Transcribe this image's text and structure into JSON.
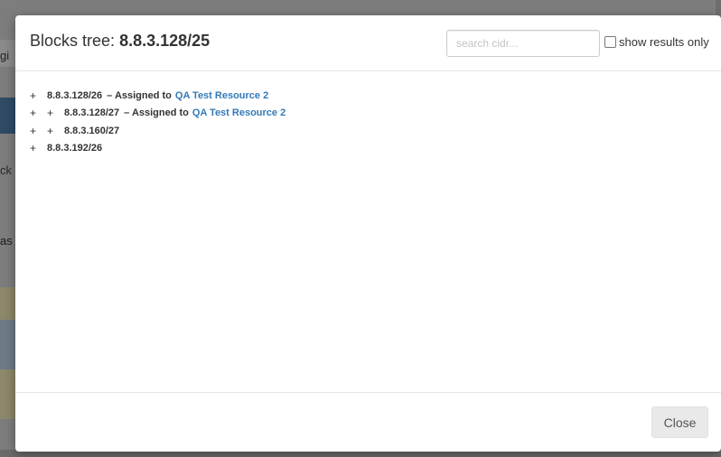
{
  "background": {
    "fragments": [
      "gi",
      "ck",
      "as"
    ]
  },
  "modal": {
    "title_prefix": "Blocks tree:",
    "title_cidr": "8.8.3.128/25",
    "search": {
      "placeholder": "search cidr...",
      "value": ""
    },
    "show_results_label": "show results only",
    "show_results_checked": false,
    "tree": [
      {
        "expanders": [
          "+"
        ],
        "cidr": "8.8.3.128/26",
        "assigned_text": "– Assigned to",
        "resource": "QA Test Resource 2"
      },
      {
        "expanders": [
          "+",
          "+"
        ],
        "cidr": "8.8.3.128/27",
        "assigned_text": "– Assigned to",
        "resource": "QA Test Resource 2"
      },
      {
        "expanders": [
          "+",
          "+"
        ],
        "cidr": "8.8.3.160/27",
        "assigned_text": "",
        "resource": ""
      },
      {
        "expanders": [
          "+"
        ],
        "cidr": "8.8.3.192/26",
        "assigned_text": "",
        "resource": ""
      }
    ],
    "close_label": "Close"
  },
  "colors": {
    "link": "#337ab7",
    "overlay": "#7d7d7d"
  }
}
